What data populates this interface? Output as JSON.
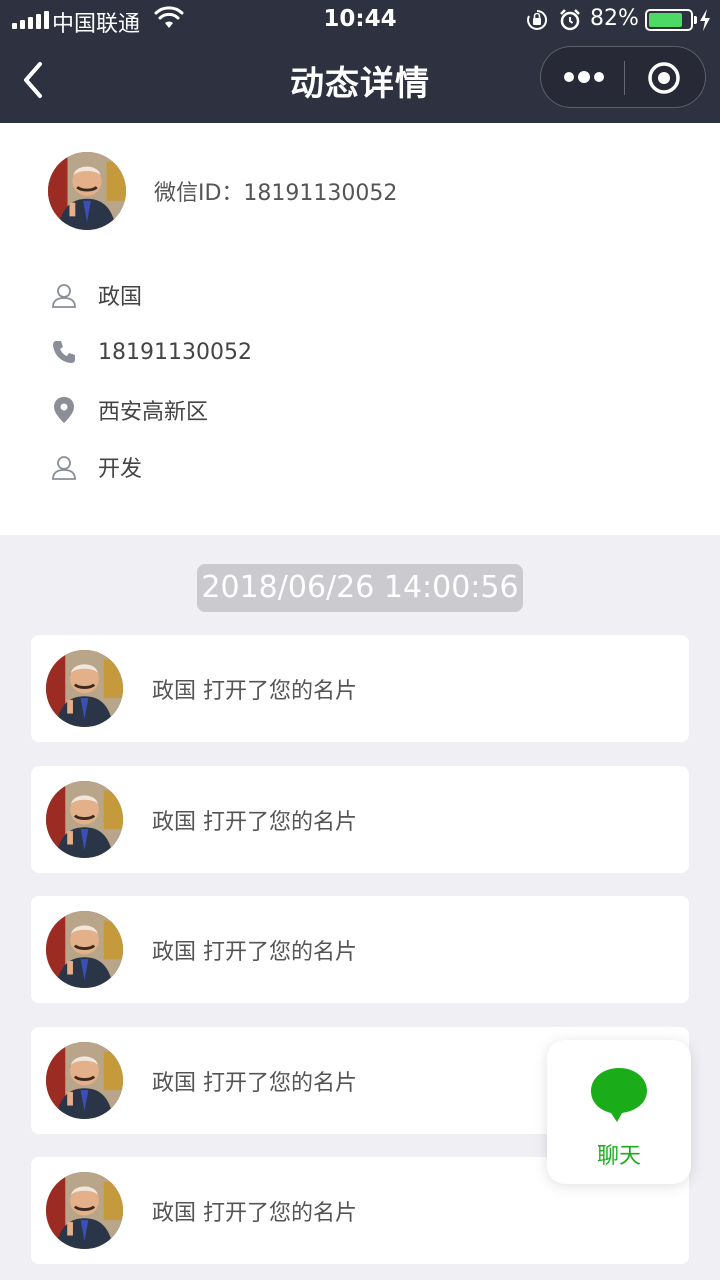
{
  "status_bar": {
    "carrier": "中国联通",
    "time": "10:44",
    "battery_percent": "82%",
    "battery_level": 0.82
  },
  "nav": {
    "title": "动态详情"
  },
  "profile": {
    "wechat_id": "微信ID：18191130052",
    "name": "政国",
    "phone": "18191130052",
    "location": "西安高新区",
    "department": "开发"
  },
  "timeline": {
    "timestamp": "2018/06/26 14:00:56",
    "items": [
      {
        "text": "政国 打开了您的名片"
      },
      {
        "text": "政国 打开了您的名片"
      },
      {
        "text": "政国 打开了您的名片"
      },
      {
        "text": "政国 打开了您的名片"
      },
      {
        "text": "政国 打开了您的名片"
      }
    ]
  },
  "chat_button": {
    "label": "聊天"
  },
  "colors": {
    "nav_bg": "#2e3140",
    "page_bg": "#efeff4",
    "accent_green": "#1aad19",
    "battery_green": "#4cd964",
    "timestamp_bg": "#cacacf",
    "icon_gray": "#8a8e99"
  }
}
